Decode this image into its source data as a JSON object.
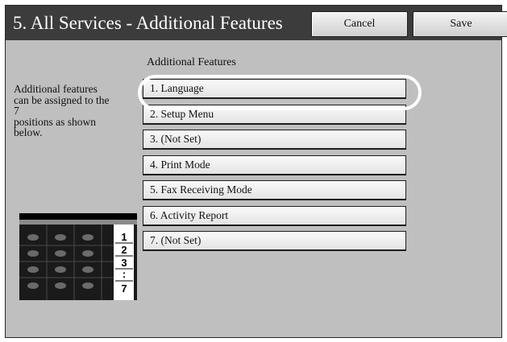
{
  "header": {
    "title": "5. All Services - Additional Features",
    "cancel_label": "Cancel",
    "save_label": "Save"
  },
  "main": {
    "section_label": "Additional Features",
    "description": "Additional features\ncan be assigned to the\n7\npositions as shown\nbelow.",
    "features": [
      {
        "label": "1.  Language"
      },
      {
        "label": "2.  Setup Menu"
      },
      {
        "label": "3.  (Not Set)"
      },
      {
        "label": "4.  Print Mode"
      },
      {
        "label": "5.  Fax Receiving Mode"
      },
      {
        "label": "6.  Activity Report"
      },
      {
        "label": "7.  (Not Set)"
      }
    ],
    "selected_index": 0,
    "illustration_numbers": [
      "1",
      "2",
      "3",
      ":",
      "7"
    ]
  },
  "colors": {
    "titlebar": "#3c3c3c",
    "background": "#bfbfbf",
    "highlight": "#ffffff"
  }
}
